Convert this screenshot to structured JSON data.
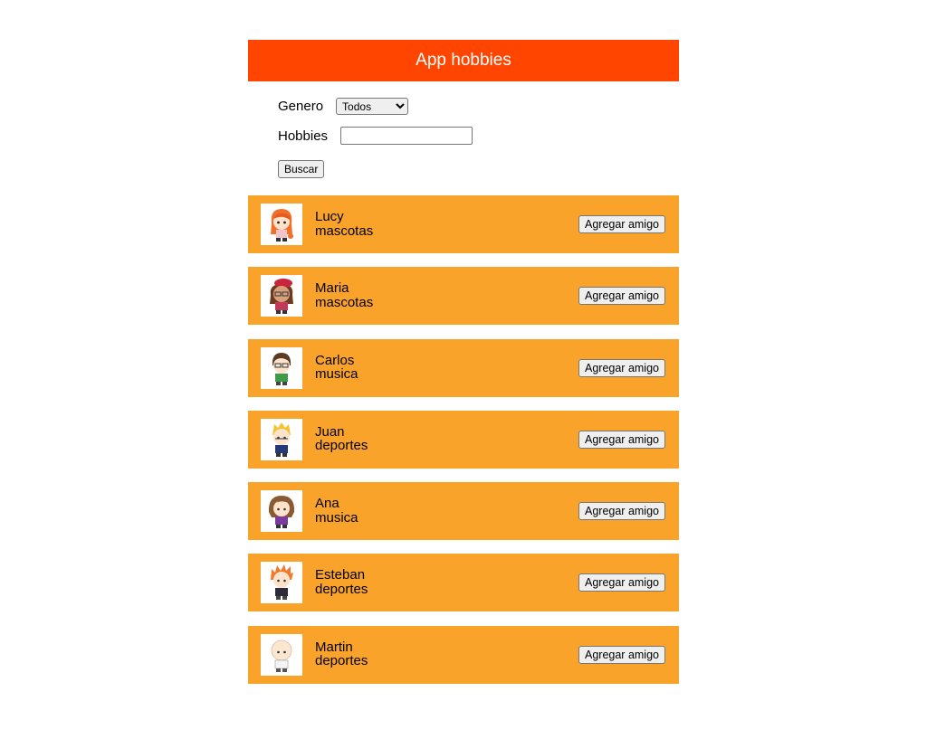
{
  "header": {
    "title": "App hobbies"
  },
  "filters": {
    "genero_label": "Genero",
    "genero_selected": "Todos",
    "hobbies_label": "Hobbies",
    "hobbies_value": "",
    "buscar_label": "Buscar"
  },
  "people": [
    {
      "name": "Lucy",
      "hobby": "mascotas",
      "button": "Agregar amigo",
      "avatar": "girl-orange-hair-avatar"
    },
    {
      "name": "Maria",
      "hobby": "mascotas",
      "button": "Agregar amigo",
      "avatar": "girl-red-hat-avatar"
    },
    {
      "name": "Carlos",
      "hobby": "musica",
      "button": "Agregar amigo",
      "avatar": "boy-glasses-avatar"
    },
    {
      "name": "Juan",
      "hobby": "deportes",
      "button": "Agregar amigo",
      "avatar": "boy-blonde-avatar"
    },
    {
      "name": "Ana",
      "hobby": "musica",
      "button": "Agregar amigo",
      "avatar": "girl-brown-hair-avatar"
    },
    {
      "name": "Esteban",
      "hobby": "deportes",
      "button": "Agregar amigo",
      "avatar": "boy-spiky-orange-avatar"
    },
    {
      "name": "Martin",
      "hobby": "deportes",
      "button": "Agregar amigo",
      "avatar": "boy-bald-avatar"
    }
  ],
  "colors": {
    "header_bg": "#ff4500",
    "card_bg": "#faa32b"
  }
}
